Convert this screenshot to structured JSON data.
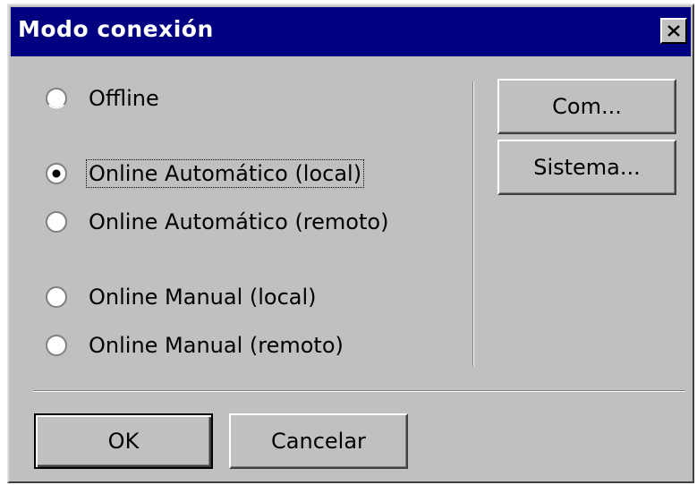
{
  "window": {
    "title": "Modo conexión"
  },
  "radio_options": [
    {
      "label": "Offline",
      "selected": false
    },
    {
      "label": "Online Automático (local)",
      "selected": true
    },
    {
      "label": "Online Automático (remoto)",
      "selected": false
    },
    {
      "label": "Online Manual (local)",
      "selected": false
    },
    {
      "label": "Online Manual (remoto)",
      "selected": false
    }
  ],
  "side_buttons": {
    "com_label": "Com...",
    "sistema_label": "Sistema..."
  },
  "footer_buttons": {
    "ok_label": "OK",
    "cancel_label": "Cancelar"
  },
  "colors": {
    "titlebar": "#000080",
    "face": "#c0c0c0"
  }
}
